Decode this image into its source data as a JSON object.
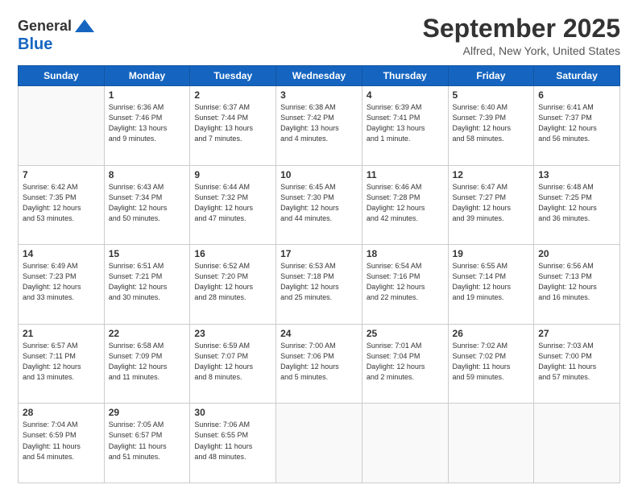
{
  "header": {
    "logo_line1": "General",
    "logo_line2": "Blue",
    "title": "September 2025",
    "subtitle": "Alfred, New York, United States"
  },
  "days_of_week": [
    "Sunday",
    "Monday",
    "Tuesday",
    "Wednesday",
    "Thursday",
    "Friday",
    "Saturday"
  ],
  "weeks": [
    [
      {
        "day": "",
        "info": ""
      },
      {
        "day": "1",
        "info": "Sunrise: 6:36 AM\nSunset: 7:46 PM\nDaylight: 13 hours\nand 9 minutes."
      },
      {
        "day": "2",
        "info": "Sunrise: 6:37 AM\nSunset: 7:44 PM\nDaylight: 13 hours\nand 7 minutes."
      },
      {
        "day": "3",
        "info": "Sunrise: 6:38 AM\nSunset: 7:42 PM\nDaylight: 13 hours\nand 4 minutes."
      },
      {
        "day": "4",
        "info": "Sunrise: 6:39 AM\nSunset: 7:41 PM\nDaylight: 13 hours\nand 1 minute."
      },
      {
        "day": "5",
        "info": "Sunrise: 6:40 AM\nSunset: 7:39 PM\nDaylight: 12 hours\nand 58 minutes."
      },
      {
        "day": "6",
        "info": "Sunrise: 6:41 AM\nSunset: 7:37 PM\nDaylight: 12 hours\nand 56 minutes."
      }
    ],
    [
      {
        "day": "7",
        "info": "Sunrise: 6:42 AM\nSunset: 7:35 PM\nDaylight: 12 hours\nand 53 minutes."
      },
      {
        "day": "8",
        "info": "Sunrise: 6:43 AM\nSunset: 7:34 PM\nDaylight: 12 hours\nand 50 minutes."
      },
      {
        "day": "9",
        "info": "Sunrise: 6:44 AM\nSunset: 7:32 PM\nDaylight: 12 hours\nand 47 minutes."
      },
      {
        "day": "10",
        "info": "Sunrise: 6:45 AM\nSunset: 7:30 PM\nDaylight: 12 hours\nand 44 minutes."
      },
      {
        "day": "11",
        "info": "Sunrise: 6:46 AM\nSunset: 7:28 PM\nDaylight: 12 hours\nand 42 minutes."
      },
      {
        "day": "12",
        "info": "Sunrise: 6:47 AM\nSunset: 7:27 PM\nDaylight: 12 hours\nand 39 minutes."
      },
      {
        "day": "13",
        "info": "Sunrise: 6:48 AM\nSunset: 7:25 PM\nDaylight: 12 hours\nand 36 minutes."
      }
    ],
    [
      {
        "day": "14",
        "info": "Sunrise: 6:49 AM\nSunset: 7:23 PM\nDaylight: 12 hours\nand 33 minutes."
      },
      {
        "day": "15",
        "info": "Sunrise: 6:51 AM\nSunset: 7:21 PM\nDaylight: 12 hours\nand 30 minutes."
      },
      {
        "day": "16",
        "info": "Sunrise: 6:52 AM\nSunset: 7:20 PM\nDaylight: 12 hours\nand 28 minutes."
      },
      {
        "day": "17",
        "info": "Sunrise: 6:53 AM\nSunset: 7:18 PM\nDaylight: 12 hours\nand 25 minutes."
      },
      {
        "day": "18",
        "info": "Sunrise: 6:54 AM\nSunset: 7:16 PM\nDaylight: 12 hours\nand 22 minutes."
      },
      {
        "day": "19",
        "info": "Sunrise: 6:55 AM\nSunset: 7:14 PM\nDaylight: 12 hours\nand 19 minutes."
      },
      {
        "day": "20",
        "info": "Sunrise: 6:56 AM\nSunset: 7:13 PM\nDaylight: 12 hours\nand 16 minutes."
      }
    ],
    [
      {
        "day": "21",
        "info": "Sunrise: 6:57 AM\nSunset: 7:11 PM\nDaylight: 12 hours\nand 13 minutes."
      },
      {
        "day": "22",
        "info": "Sunrise: 6:58 AM\nSunset: 7:09 PM\nDaylight: 12 hours\nand 11 minutes."
      },
      {
        "day": "23",
        "info": "Sunrise: 6:59 AM\nSunset: 7:07 PM\nDaylight: 12 hours\nand 8 minutes."
      },
      {
        "day": "24",
        "info": "Sunrise: 7:00 AM\nSunset: 7:06 PM\nDaylight: 12 hours\nand 5 minutes."
      },
      {
        "day": "25",
        "info": "Sunrise: 7:01 AM\nSunset: 7:04 PM\nDaylight: 12 hours\nand 2 minutes."
      },
      {
        "day": "26",
        "info": "Sunrise: 7:02 AM\nSunset: 7:02 PM\nDaylight: 11 hours\nand 59 minutes."
      },
      {
        "day": "27",
        "info": "Sunrise: 7:03 AM\nSunset: 7:00 PM\nDaylight: 11 hours\nand 57 minutes."
      }
    ],
    [
      {
        "day": "28",
        "info": "Sunrise: 7:04 AM\nSunset: 6:59 PM\nDaylight: 11 hours\nand 54 minutes."
      },
      {
        "day": "29",
        "info": "Sunrise: 7:05 AM\nSunset: 6:57 PM\nDaylight: 11 hours\nand 51 minutes."
      },
      {
        "day": "30",
        "info": "Sunrise: 7:06 AM\nSunset: 6:55 PM\nDaylight: 11 hours\nand 48 minutes."
      },
      {
        "day": "",
        "info": ""
      },
      {
        "day": "",
        "info": ""
      },
      {
        "day": "",
        "info": ""
      },
      {
        "day": "",
        "info": ""
      }
    ]
  ]
}
